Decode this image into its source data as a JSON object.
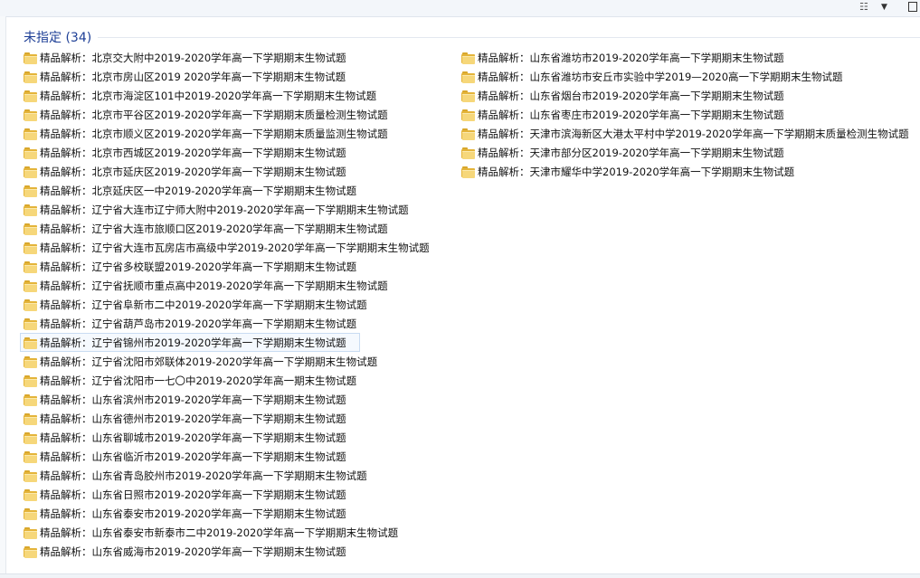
{
  "toolbar": {
    "view_icon": "view-options-icon",
    "view_arrow": "▼",
    "pane_icon": "preview-pane-icon"
  },
  "group": {
    "title": "未指定 (34)"
  },
  "columns": [
    [
      "精品解析：北京交大附中2019-2020学年高一下学期期末生物试题",
      "精品解析：北京市房山区2019 2020学年高一下学期期末生物试题",
      "精品解析：北京市海淀区101中2019-2020学年高一下学期期末生物试题",
      "精品解析：北京市平谷区2019-2020学年高一下学期期末质量检测生物试题",
      "精品解析：北京市顺义区2019-2020学年高一下学期期末质量监测生物试题",
      "精品解析：北京市西城区2019-2020学年高一下学期期末生物试题",
      "精品解析：北京市延庆区2019-2020学年高一下学期期末生物试题",
      "精品解析：北京延庆区一中2019-2020学年高一下学期期末生物试题",
      "精品解析：辽宁省大连市辽宁师大附中2019-2020学年高一下学期期末生物试题",
      "精品解析：辽宁省大连市旅顺口区2019-2020学年高一下学期期末生物试题",
      "精品解析：辽宁省大连市瓦房店市高级中学2019-2020学年高一下学期期末生物试题",
      "精品解析：辽宁省多校联盟2019-2020学年高一下学期期末生物试题",
      "精品解析：辽宁省抚顺市重点高中2019-2020学年高一下学期期末生物试题",
      "精品解析：辽宁省阜新市二中2019-2020学年高一下学期期末生物试题",
      "精品解析：辽宁省葫芦岛市2019-2020学年高一下学期期末生物试题",
      "精品解析：辽宁省锦州市2019-2020学年高一下学期期末生物试题",
      "精品解析：辽宁省沈阳市郊联体2019-2020学年高一下学期期末生物试题",
      "精品解析：辽宁省沈阳市一七〇中2019-2020学年高一期末生物试题",
      "精品解析：山东省滨州市2019-2020学年高一下学期期末生物试题",
      "精品解析：山东省德州市2019-2020学年高一下学期期末生物试题",
      "精品解析：山东省聊城市2019-2020学年高一下学期期末生物试题",
      "精品解析：山东省临沂市2019-2020学年高一下学期期末生物试题",
      "精品解析：山东省青岛胶州市2019-2020学年高一下学期期末生物试题",
      "精品解析：山东省日照市2019-2020学年高一下学期期末生物试题",
      "精品解析：山东省泰安市2019-2020学年高一下学期期末生物试题",
      "精品解析：山东省泰安市新泰市二中2019-2020学年高一下学期期末生物试题",
      "精品解析：山东省威海市2019-2020学年高一下学期期末生物试题"
    ],
    [
      "精品解析：山东省潍坊市2019-2020学年高一下学期期末生物试题",
      "精品解析：山东省潍坊市安丘市实验中学2019—2020高一下学期期末生物试题",
      "精品解析：山东省烟台市2019-2020学年高一下学期期末生物试题",
      "精品解析：山东省枣庄市2019-2020学年高一下学期期末生物试题",
      "精品解析：天津市滨海新区大港太平村中学2019-2020学年高一下学期期末质量检测生物试题",
      "精品解析：天津市部分区2019-2020学年高一下学期期末生物试题",
      "精品解析：天津市耀华中学2019-2020学年高一下学期期末生物试题"
    ]
  ],
  "selected": {
    "column": 0,
    "index": 15
  }
}
